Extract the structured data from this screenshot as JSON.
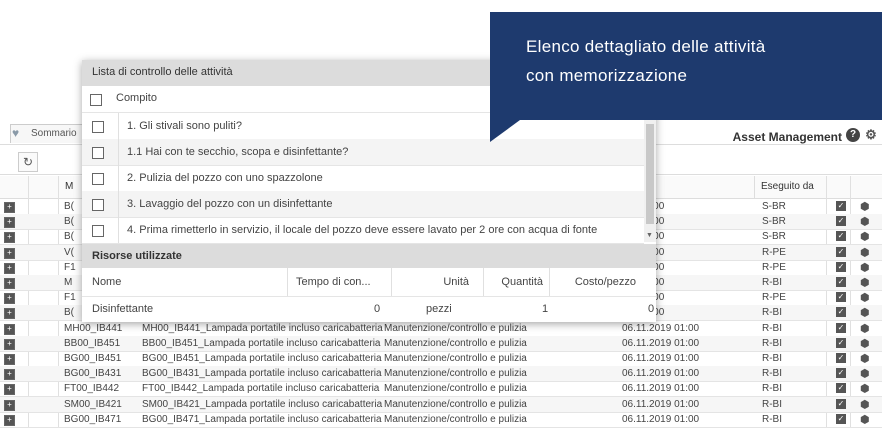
{
  "callout": {
    "line1": "Elenco dettagliato delle attività",
    "line2": "con memorizzazione"
  },
  "background": {
    "tab_label": "Sommario",
    "app_title": "Asset Management",
    "help_icon": "?",
    "gear_icon": "gear-icon",
    "refresh_icon": "refresh-icon",
    "columns": {
      "col_m": "M",
      "eseguito_da": "Eseguito da"
    },
    "rows": [
      {
        "id": "B(",
        "name": "",
        "type": "",
        "date": ")19 01:00",
        "by": "S-BR"
      },
      {
        "id": "B(",
        "name": "",
        "type": "",
        "date": ")19 01:00",
        "by": "S-BR"
      },
      {
        "id": "B(",
        "name": "",
        "type": "",
        "date": ")19 01:00",
        "by": "S-BR"
      },
      {
        "id": "V(",
        "name": "",
        "type": "",
        "date": ")19 01:00",
        "by": "R-PE"
      },
      {
        "id": "F1",
        "name": "",
        "type": "",
        "date": ")19 01:00",
        "by": "R-PE"
      },
      {
        "id": "M",
        "name": "",
        "type": "",
        "date": ")19 01:00",
        "by": "R-BI"
      },
      {
        "id": "F1",
        "name": "",
        "type": "",
        "date": ")19 01:00",
        "by": "R-PE"
      },
      {
        "id": "B(",
        "name": "",
        "type": "",
        "date": ")19 01:00",
        "by": "R-BI"
      },
      {
        "id": "MH00_IB441",
        "name": "MH00_IB441_Lampada portatile incluso caricabatteria",
        "type": "Manutenzione/controllo e pulizia",
        "date": "06.11.2019 01:00",
        "by": "R-BI"
      },
      {
        "id": "BB00_IB451",
        "name": "BB00_IB451_Lampada portatile incluso caricabatteria",
        "type": "Manutenzione/controllo e pulizia",
        "date": "06.11.2019 01:00",
        "by": "R-BI"
      },
      {
        "id": "BG00_IB451",
        "name": "BG00_IB451_Lampada portatile incluso caricabatteria",
        "type": "Manutenzione/controllo e pulizia",
        "date": "06.11.2019 01:00",
        "by": "R-BI"
      },
      {
        "id": "BG00_IB431",
        "name": "BG00_IB431_Lampada portatile incluso caricabatteria",
        "type": "Manutenzione/controllo e pulizia",
        "date": "06.11.2019 01:00",
        "by": "R-BI"
      },
      {
        "id": "FT00_IB442",
        "name": "FT00_IB442_Lampada portatile incluso caricabatteria",
        "type": "Manutenzione/controllo e pulizia",
        "date": "06.11.2019 01:00",
        "by": "R-BI"
      },
      {
        "id": "SM00_IB421",
        "name": "SM00_IB421_Lampada portatile incluso caricabatteria",
        "type": "Manutenzione/controllo e pulizia",
        "date": "06.11.2019 01:00",
        "by": "R-BI"
      },
      {
        "id": "BG00_IB471",
        "name": "BG00_IB471_Lampada portatile incluso caricabatteria",
        "type": "Manutenzione/controllo e pulizia",
        "date": "06.11.2019 01:00",
        "by": "R-BI"
      }
    ]
  },
  "popup": {
    "title": "Lista di controllo delle attività",
    "task_column": "Compito",
    "tasks": [
      "1. Gli stivali sono puliti?",
      "1.1 Hai con te secchio, scopa e disinfettante?",
      "2. Pulizia del pozzo con uno spazzolone",
      "3. Lavaggio del pozzo con un disinfettante",
      "4. Prima rimetterlo in servizio, il locale del pozzo deve essere lavato per 2 ore con acqua di fonte"
    ],
    "resources_title": "Risorse utilizzate",
    "resources_columns": {
      "nome": "Nome",
      "tempo": "Tempo di con...",
      "unita": "Unità",
      "quantita": "Quantità",
      "costo": "Costo/pezzo"
    },
    "resources": [
      {
        "nome": "Disinfettante",
        "tempo": "0",
        "unita": "pezzi",
        "quantita": "1",
        "costo": "0"
      }
    ]
  }
}
